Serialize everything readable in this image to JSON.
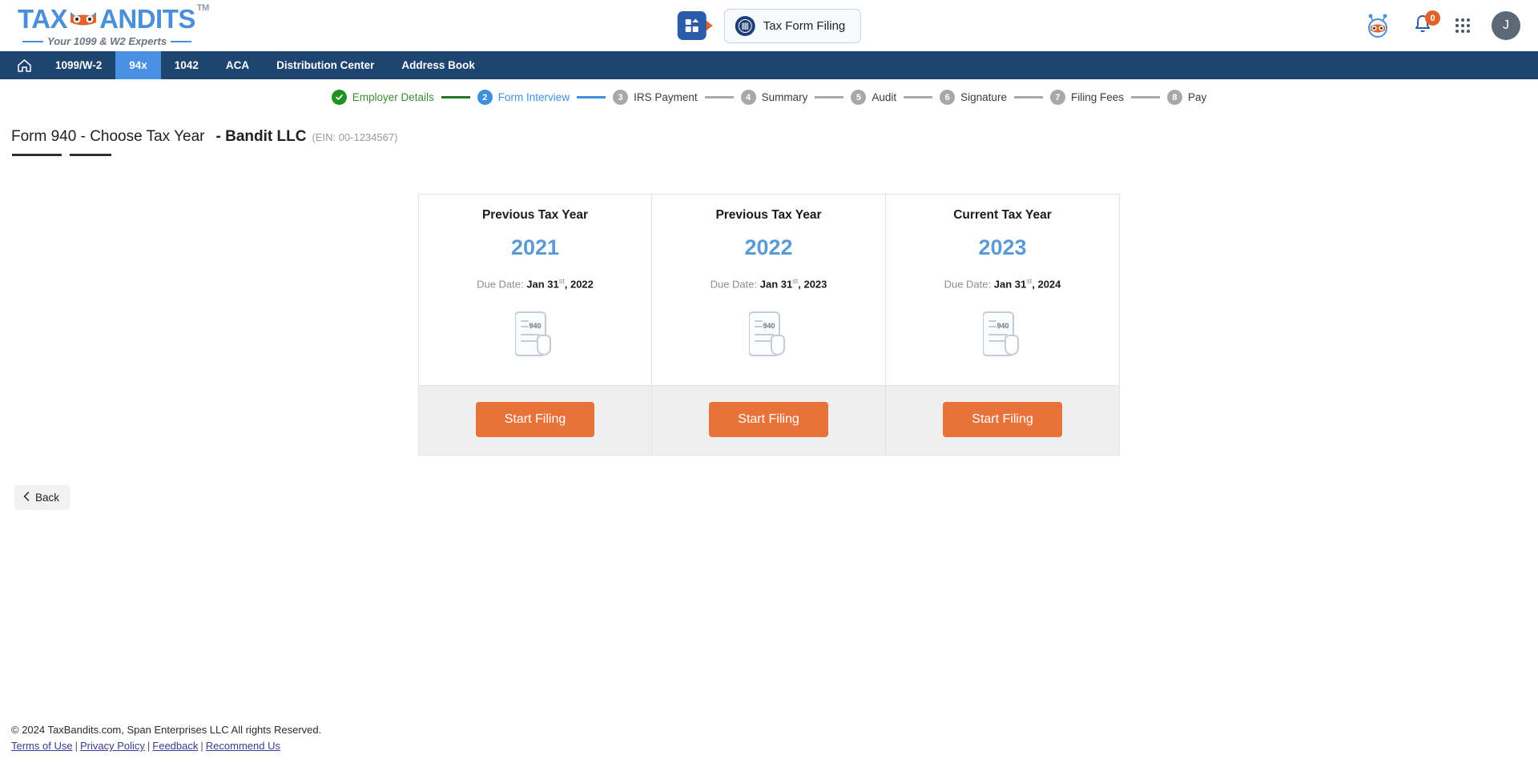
{
  "brand": {
    "name_part1": "TAX",
    "name_part2": "ANDITS",
    "tm": "TM",
    "tagline": "Your 1099 & W2 Experts",
    "logo_blue": "#4a90d9",
    "mask_orange": "#e2622a"
  },
  "header": {
    "dashboard_icon": "dashboard-grid-icon",
    "tax_form_filing_label": "Tax Form Filing",
    "seal_icon": "irs-seal-icon",
    "bot_icon": "bandit-bot-icon",
    "bell_icon": "notification-bell-icon",
    "notification_count": "0",
    "apps_icon": "apps-grid-icon",
    "avatar_initial": "J"
  },
  "nav": {
    "home_icon": "home-icon",
    "items": [
      {
        "label": "1099/W-2",
        "active": false
      },
      {
        "label": "94x",
        "active": true
      },
      {
        "label": "1042",
        "active": false
      },
      {
        "label": "ACA",
        "active": false
      },
      {
        "label": "Distribution Center",
        "active": false
      },
      {
        "label": "Address Book",
        "active": false
      }
    ],
    "bg": "#1e4470",
    "active_bg": "#4a90e2"
  },
  "wizard": {
    "steps": [
      {
        "num": "1",
        "label": "Employer Details",
        "state": "done"
      },
      {
        "num": "2",
        "label": "Form Interview",
        "state": "active"
      },
      {
        "num": "3",
        "label": "IRS Payment",
        "state": "todo"
      },
      {
        "num": "4",
        "label": "Summary",
        "state": "todo"
      },
      {
        "num": "5",
        "label": "Audit",
        "state": "todo"
      },
      {
        "num": "6",
        "label": "Signature",
        "state": "todo"
      },
      {
        "num": "7",
        "label": "Filing Fees",
        "state": "todo"
      },
      {
        "num": "8",
        "label": "Pay",
        "state": "todo"
      }
    ],
    "done_color": "#219121",
    "active_color": "#3f8fdf",
    "todo_color": "#a8a8a8"
  },
  "page": {
    "title": "Form 940 - Choose Tax Year",
    "company": "- Bandit LLC",
    "ein": "(EIN: 00-1234567)"
  },
  "cards": [
    {
      "kicker": "Previous Tax Year",
      "year": "2021",
      "due_label": "Due Date:",
      "due_month_day": "Jan 31",
      "due_ordinal": "st",
      "due_year": ", 2022",
      "form_number": "940",
      "doc_icon": "form-940-document-icon",
      "button_label": "Start Filing"
    },
    {
      "kicker": "Previous Tax Year",
      "year": "2022",
      "due_label": "Due Date:",
      "due_month_day": "Jan 31",
      "due_ordinal": "st",
      "due_year": ", 2023",
      "form_number": "940",
      "doc_icon": "form-940-document-icon",
      "button_label": "Start Filing"
    },
    {
      "kicker": "Current Tax Year",
      "year": "2023",
      "due_label": "Due Date:",
      "due_month_day": "Jan 31",
      "due_ordinal": "st",
      "due_year": ", 2024",
      "form_number": "940",
      "doc_icon": "form-940-document-icon",
      "button_label": "Start Filing"
    }
  ],
  "back": {
    "label": "Back",
    "icon": "chevron-left-icon"
  },
  "footer": {
    "copyright": "© 2024 TaxBandits.com, Span Enterprises LLC All rights Reserved.",
    "links": [
      "Terms of Use",
      "Privacy Policy",
      "Feedback",
      "Recommend Us"
    ],
    "separator": "|"
  },
  "colors": {
    "accent_orange": "#e8733a",
    "year_blue": "#5b9bd5",
    "nav_navy": "#1e4470"
  }
}
